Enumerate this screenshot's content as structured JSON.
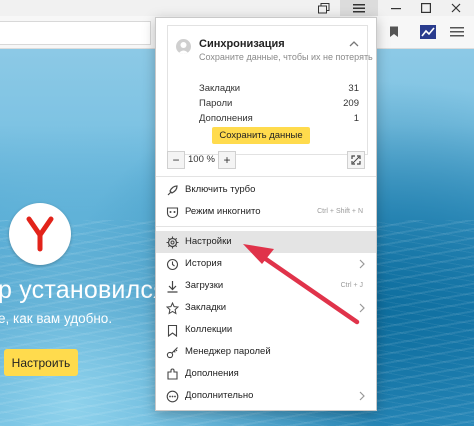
{
  "colors": {
    "accent_yellow": "#ffdb4d",
    "annotation_arrow": "#e0334a",
    "logo_red": "#e2231a",
    "menu_highlight": "#e4e4e4"
  },
  "page": {
    "hero_title": "р установился",
    "hero_subtitle": "е, как вам удобно.",
    "hero_button": "Настроить"
  },
  "menu": {
    "sync": {
      "title": "Синхронизация",
      "description": "Сохраните данные, чтобы их не потерять",
      "rows": [
        {
          "label": "Закладки",
          "count": "31"
        },
        {
          "label": "Пароли",
          "count": "209"
        },
        {
          "label": "Дополнения",
          "count": "1"
        }
      ],
      "save_button": "Сохранить данные"
    },
    "zoom": {
      "minus": "−",
      "value": "100 %",
      "plus": "+"
    },
    "items": [
      {
        "label": "Включить турбо",
        "icon": "rocket-icon"
      },
      {
        "label": "Режим инкогнито",
        "icon": "incognito-icon",
        "shortcut": "Ctrl + Shift + N"
      },
      {
        "label": "Настройки",
        "icon": "gear-icon",
        "highlighted": true
      },
      {
        "label": "История",
        "icon": "history-icon",
        "submenu": true
      },
      {
        "label": "Загрузки",
        "icon": "download-icon",
        "shortcut": "Ctrl + J"
      },
      {
        "label": "Закладки",
        "icon": "star-icon",
        "submenu": true
      },
      {
        "label": "Коллекции",
        "icon": "collections-icon"
      },
      {
        "label": "Менеджер паролей",
        "icon": "key-icon"
      },
      {
        "label": "Дополнения",
        "icon": "addons-icon"
      },
      {
        "label": "Дополнительно",
        "icon": "more-icon",
        "submenu": true
      }
    ]
  }
}
